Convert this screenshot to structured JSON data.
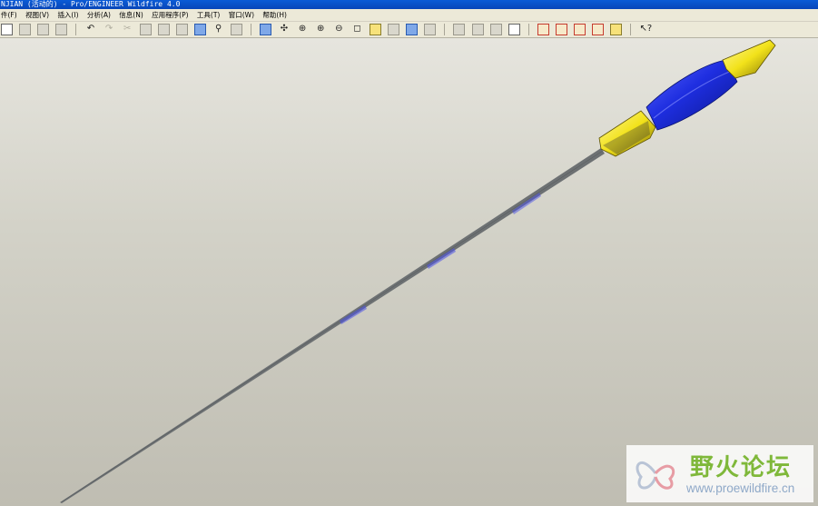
{
  "window": {
    "title": "NJIAN (活动的) - Pro/ENGINEER Wildfire 4.0"
  },
  "menubar": {
    "items": [
      "件(F)",
      "视图(V)",
      "插入(I)",
      "分析(A)",
      "信息(N)",
      "应用程序(P)",
      "工具(T)",
      "窗口(W)",
      "帮助(H)"
    ]
  },
  "toolbar": {
    "icons": [
      "new-icon",
      "print-icon",
      "print-preview-icon",
      "email-icon",
      "undo-icon",
      "redo-icon",
      "cut-icon",
      "copy-icon",
      "paste-icon",
      "paste-special-icon",
      "regenerate-icon",
      "find-icon",
      "select-box-icon",
      "repaint-icon",
      "spin-center-icon",
      "orient-icon",
      "zoom-in-icon",
      "zoom-out-icon",
      "refit-icon",
      "reorient-icon",
      "saved-views-icon",
      "layers-icon",
      "view-manager-icon",
      "wireframe-icon",
      "hidden-line-icon",
      "no-hidden-icon",
      "shading-icon",
      "datum-planes-icon",
      "datum-axes-icon",
      "datum-points-icon",
      "coordinate-systems-icon",
      "annotations-icon",
      "context-help-icon"
    ]
  },
  "watermark": {
    "chinese": "野火论坛",
    "url": "www.proewildfire.cn"
  },
  "colors": {
    "handle_blue": "#1e2ee0",
    "collar_yellow": "#f2e21a",
    "shaft_grey": "#7c8082",
    "viewport_bg": "#d3d2c8"
  }
}
